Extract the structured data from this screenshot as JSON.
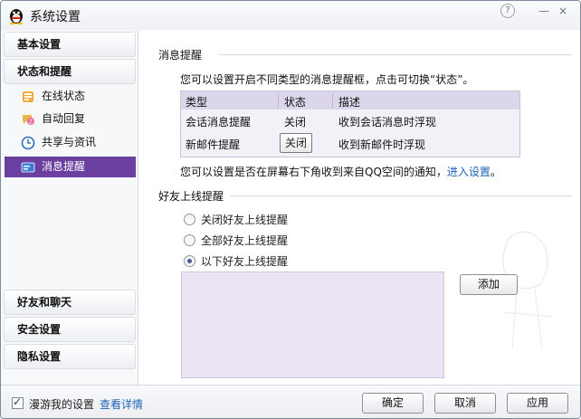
{
  "window": {
    "title": "系统设置",
    "help_icon": "?",
    "min_icon": "—",
    "close_icon": "×"
  },
  "sidebar": {
    "sections": [
      {
        "label": "基本设置"
      },
      {
        "label": "状态和提醒"
      },
      {
        "label": "好友和聊天"
      },
      {
        "label": "安全设置"
      },
      {
        "label": "隐私设置"
      }
    ],
    "items": [
      {
        "label": "在线状态",
        "icon": "online-status-icon"
      },
      {
        "label": "自动回复",
        "icon": "auto-reply-icon"
      },
      {
        "label": "共享与资讯",
        "icon": "clock-icon"
      },
      {
        "label": "消息提醒",
        "icon": "message-alert-icon",
        "active": true
      }
    ],
    "accent": "#6b3fa0"
  },
  "content": {
    "msg_section": {
      "title": "消息提醒",
      "description": "您可以设置开启不同类型的消息提醒框，点击可切换“状态”。",
      "table": {
        "headers": [
          "类型",
          "状态",
          "描述"
        ],
        "rows": [
          {
            "type": "会话消息提醒",
            "status": "关闭",
            "desc": "收到会话消息时浮现"
          },
          {
            "type": "新邮件提醒",
            "status": "关闭",
            "desc": "收到新邮件时浮现"
          }
        ]
      },
      "note": "您可以设置是否在屏幕右下角收到来自QQ空间的通知，",
      "note_link": "进入设置",
      "note_end": "。"
    },
    "friend_section": {
      "title": "好友上线提醒",
      "options": [
        {
          "label": "关闭好友上线提醒",
          "checked": false
        },
        {
          "label": "全部好友上线提醒",
          "checked": false
        },
        {
          "label": "以下好友上线提醒",
          "checked": true
        }
      ],
      "add_button": "添加"
    }
  },
  "footer": {
    "roaming_label": "漫游我的设置",
    "roaming_checked": true,
    "details_link": "查看详情",
    "ok": "确定",
    "cancel": "取消",
    "apply": "应用"
  }
}
